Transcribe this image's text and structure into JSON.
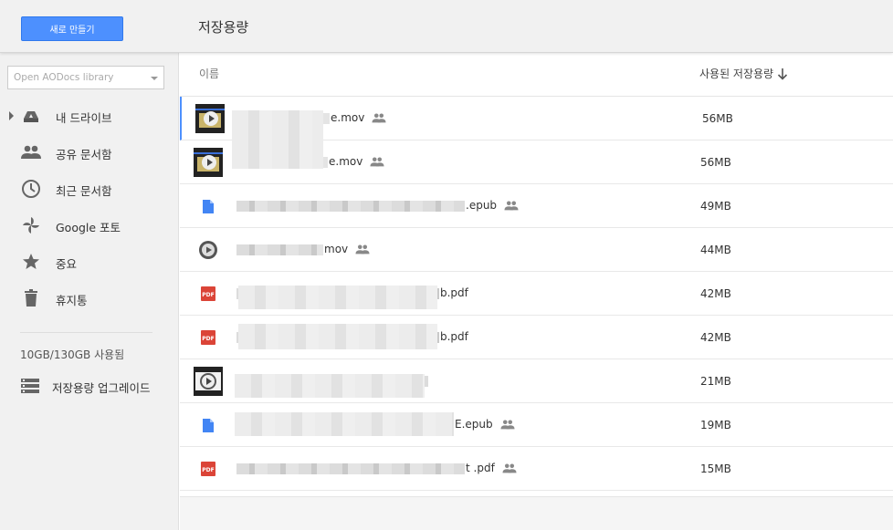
{
  "header": {
    "new_button": "새로 만들기",
    "title": "저장용량"
  },
  "sidebar": {
    "library_placeholder": "Open AODocs library",
    "items": [
      {
        "label": "내 드라이브",
        "icon": "drive-icon"
      },
      {
        "label": "공유 문서함",
        "icon": "people-icon"
      },
      {
        "label": "최근 문서함",
        "icon": "clock-icon"
      },
      {
        "label": "Google 포토",
        "icon": "pinwheel-icon"
      },
      {
        "label": "중요",
        "icon": "star-icon"
      },
      {
        "label": "휴지통",
        "icon": "trash-icon"
      }
    ],
    "storage_used": "10GB/130GB 사용됨",
    "upgrade_label": "저장용량 업그레이드"
  },
  "table": {
    "col_name": "이름",
    "col_size": "사용된 저장용량",
    "rows": [
      {
        "name_suffix": "e.mov",
        "size": "56MB",
        "type": "video-thumb",
        "shared": true
      },
      {
        "name_suffix": "e.mov",
        "size": "56MB",
        "type": "video-thumb",
        "shared": true
      },
      {
        "name_suffix": ".epub",
        "size": "49MB",
        "type": "doc",
        "shared": true
      },
      {
        "name_suffix": "mov",
        "size": "44MB",
        "type": "video-round",
        "shared": true
      },
      {
        "name_suffix": "b.pdf",
        "size": "42MB",
        "type": "pdf",
        "shared": false
      },
      {
        "name_suffix": "b.pdf",
        "size": "42MB",
        "type": "pdf",
        "shared": false
      },
      {
        "name_suffix": "",
        "size": "21MB",
        "type": "video-thumb",
        "shared": false
      },
      {
        "name_suffix": "E.epub",
        "size": "19MB",
        "type": "doc",
        "shared": true
      },
      {
        "name_suffix": "t .pdf",
        "size": "15MB",
        "type": "pdf",
        "shared": true
      }
    ]
  },
  "colors": {
    "accent": "#4d90fe",
    "pdf": "#db4437",
    "doc": "#4285f4"
  }
}
